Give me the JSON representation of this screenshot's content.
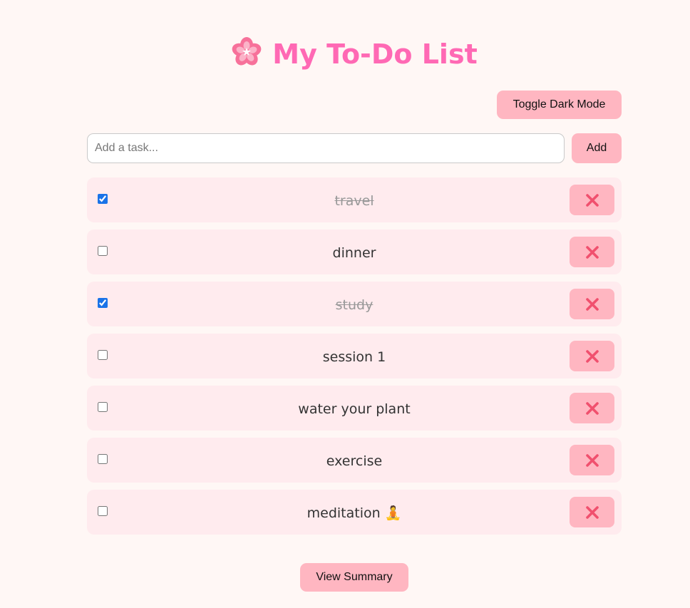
{
  "header": {
    "title": "My To-Do List",
    "icon": "cherry-blossom-icon"
  },
  "toolbar": {
    "toggle_dark_mode_label": "Toggle Dark Mode"
  },
  "input": {
    "placeholder": "Add a task...",
    "value": "",
    "add_label": "Add"
  },
  "tasks": [
    {
      "text": "travel",
      "done": true
    },
    {
      "text": "dinner",
      "done": false
    },
    {
      "text": "study",
      "done": true
    },
    {
      "text": "session 1",
      "done": false
    },
    {
      "text": "water your plant",
      "done": false
    },
    {
      "text": "exercise",
      "done": false
    },
    {
      "text": "meditation 🧘",
      "done": false
    }
  ],
  "footer": {
    "summary_label": "View Summary"
  },
  "colors": {
    "background": "#fff7f5",
    "accent": "#ff69b4",
    "button": "#ffb6c1",
    "task_bg": "#ffebee",
    "delete_icon": "#f0506e"
  }
}
